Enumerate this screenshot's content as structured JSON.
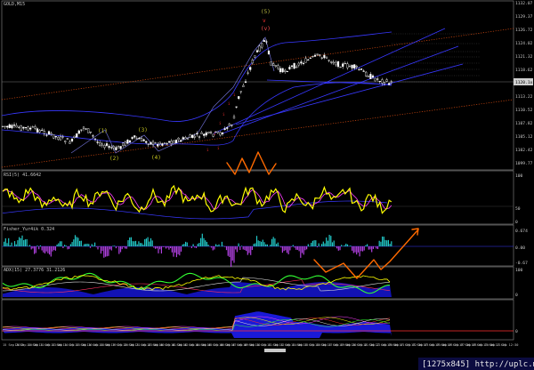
{
  "window": {
    "symbol_title": "GOLD,M15"
  },
  "price_axis": {
    "ticks": [
      "1132.07",
      "1129.37",
      "1126.72",
      "1124.02",
      "1121.32",
      "1118.62",
      "1115.92",
      "1113.22",
      "1110.52",
      "1107.82",
      "1105.12",
      "1102.42",
      "1099.77"
    ],
    "current_price": "1120.1x"
  },
  "wave_labels": {
    "top": [
      "(5)",
      "v",
      "(v)"
    ],
    "bottom": [
      "(1)",
      "(2)",
      "(3)",
      "(4)"
    ],
    "top_colors": [
      "#b8b840",
      "#ff3030",
      "#ff5050"
    ]
  },
  "indicators": {
    "rsi": {
      "title": "RSI(5) 41.6642",
      "ticks": [
        "100",
        "50",
        "0"
      ]
    },
    "fisher": {
      "title": "Fisher_Yur4ik 0.324",
      "ticks": [
        "0.674",
        "0.00",
        "-0.67"
      ]
    },
    "adx": {
      "title": "ADX(15) 27.3776 31.2126",
      "ticks": [
        "100",
        "0"
      ]
    },
    "bottom_pane": {
      "ticks": [
        "0"
      ]
    }
  },
  "time_axis": [
    "15 Sep 2015",
    "15 Sep 10:30",
    "15 Sep 11:45",
    "15 Sep 13:00",
    "15 Sep 14:15",
    "15 Sep 15:30",
    "15 Sep 16:45",
    "15 Sep 18:00",
    "15 Sep 19:15",
    "15 Sep 20:30",
    "15 Sep 21:45",
    "15 Sep 23:00",
    "16 Sep 00:15",
    "16 Sep 01:30",
    "16 Sep 02:45",
    "16 Sep 04:00",
    "16 Sep 05:15",
    "16 Sep 06:30",
    "16 Sep 07:45",
    "16 Sep 09:00",
    "16 Sep 10:15",
    "16 Sep 11:30",
    "16 Sep 12:45",
    "16 Sep 14:00",
    "16 Sep 15:15",
    "16 Sep 16:30",
    "16 Sep 17:45",
    "16 Sep 19:00",
    "16 Sep 20:15",
    "16 Sep 21:30",
    "16 Sep 22:45",
    "17 Sep 00:00",
    "17 Sep 01:15",
    "17 Sep 02:30",
    "17 Sep 03:45",
    "17 Sep 05:00",
    "17 Sep 06:15",
    "17 Sep 07:30",
    "17 Sep 08:45",
    "17 Sep 10:00",
    "17 Sep 11:15",
    "17 Sep 12:30"
  ],
  "watermark": "[1275x845]  http://uplc.me/",
  "colors": {
    "background": "#000000",
    "candle": "#ffffff",
    "rsi_line": "#ffff00",
    "rsi_signal": "#ff40ff",
    "fisher_pos": "#22c8c8",
    "fisher_neg": "#b040e0",
    "adx_line": "#33ff33",
    "channel": "#4040ff",
    "hand_drawn": "#ff6a00"
  }
}
